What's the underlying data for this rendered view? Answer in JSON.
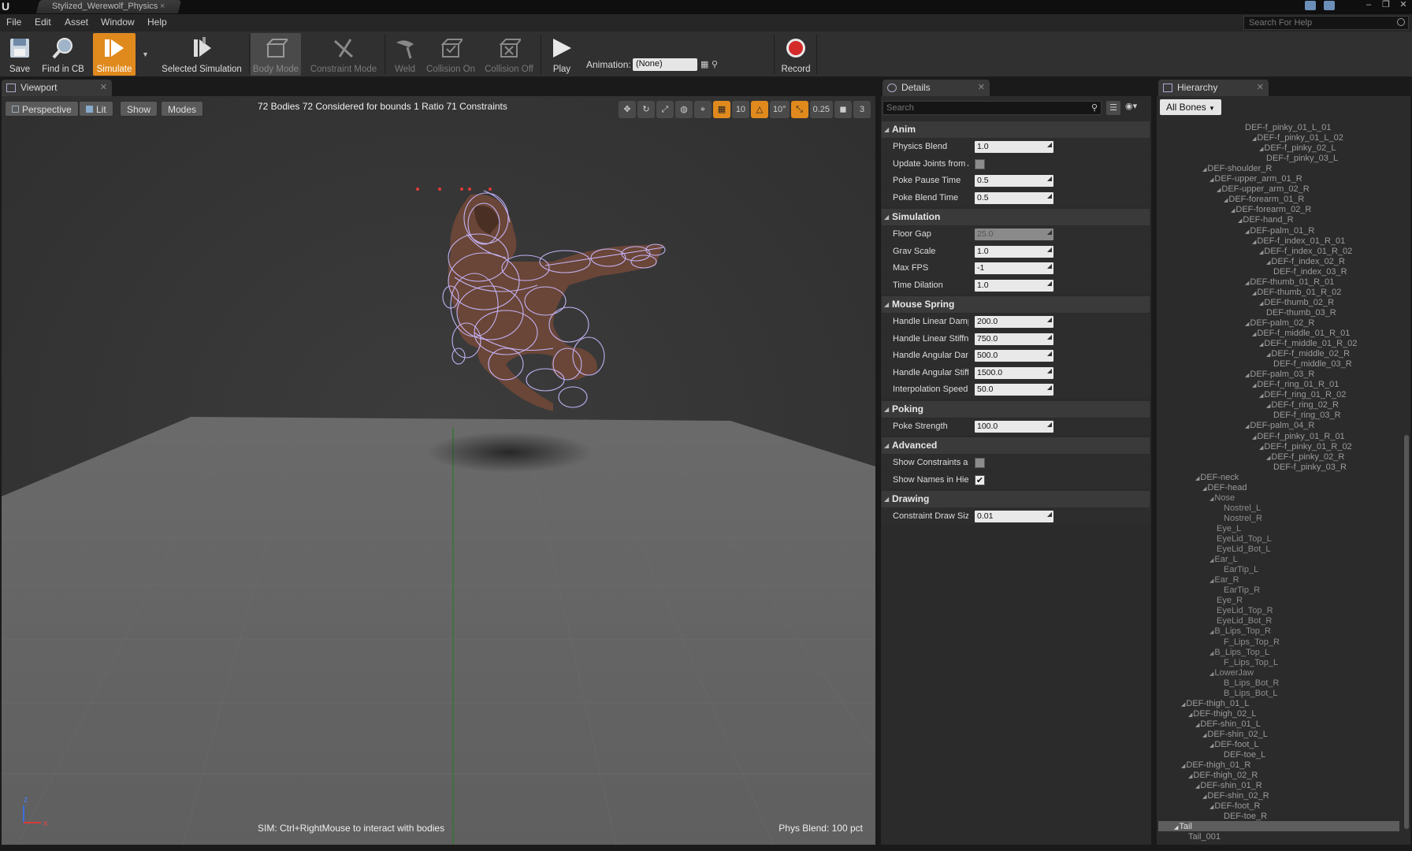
{
  "title_bar": {
    "logo": "U",
    "document_tab": "Stylized_Werewolf_Physics",
    "close": "×"
  },
  "menu": {
    "items": [
      "File",
      "Edit",
      "Asset",
      "Window",
      "Help"
    ],
    "help_search_placeholder": "Search For Help"
  },
  "toolbar": {
    "save": "Save",
    "find_in_cb": "Find in CB",
    "simulate": "Simulate",
    "selected_simulation": "Selected Simulation",
    "body_mode": "Body Mode",
    "constraint_mode": "Constraint Mode",
    "weld": "Weld",
    "collision_on": "Collision On",
    "collision_off": "Collision Off",
    "play": "Play",
    "animation_label": "Animation:",
    "animation_value": "(None)",
    "record": "Record"
  },
  "viewport": {
    "tab_label": "Viewport",
    "perspective": "Perspective",
    "lit": "Lit",
    "show": "Show",
    "modes": "Modes",
    "stats": "72 Bodies  72 Considered for bounds  1 Ratio  71 Constraints",
    "grid_snap": "10",
    "rot_snap": "10°",
    "scale_snap": "0.25",
    "cam_speed": "3",
    "hint": "SIM: Ctrl+RightMouse to interact with bodies",
    "phys_blend": "Phys Blend: 100 pct",
    "axis_x": "x",
    "axis_z": "z"
  },
  "details": {
    "tab_label": "Details",
    "search_placeholder": "Search",
    "categories": [
      {
        "name": "Anim",
        "props": [
          {
            "label": "Physics Blend",
            "value": "1.0"
          },
          {
            "label": "Update Joints from Animation",
            "checkbox": false
          },
          {
            "label": "Poke Pause Time",
            "value": "0.5"
          },
          {
            "label": "Poke Blend Time",
            "value": "0.5"
          }
        ]
      },
      {
        "name": "Simulation",
        "props": [
          {
            "label": "Floor Gap",
            "value": "25.0",
            "disabled": true
          },
          {
            "label": "Grav Scale",
            "value": "1.0"
          },
          {
            "label": "Max FPS",
            "value": "-1"
          },
          {
            "label": "Time Dilation",
            "value": "1.0"
          }
        ]
      },
      {
        "name": "Mouse Spring",
        "props": [
          {
            "label": "Handle Linear Damping",
            "value": "200.0"
          },
          {
            "label": "Handle Linear Stiffness",
            "value": "750.0"
          },
          {
            "label": "Handle Angular Damping",
            "value": "500.0"
          },
          {
            "label": "Handle Angular Stiffness",
            "value": "1500.0"
          },
          {
            "label": "Interpolation Speed",
            "value": "50.0"
          }
        ]
      },
      {
        "name": "Poking",
        "props": [
          {
            "label": "Poke Strength",
            "value": "100.0"
          }
        ]
      },
      {
        "name": "Advanced",
        "props": [
          {
            "label": "Show Constraints as Points",
            "checkbox": false
          },
          {
            "label": "Show Names in Hierarchy",
            "checkbox": true
          }
        ]
      },
      {
        "name": "Drawing",
        "props": [
          {
            "label": "Constraint Draw Size",
            "value": "0.01"
          }
        ]
      }
    ]
  },
  "hierarchy": {
    "tab_label": "Hierarchy",
    "filter": "All Bones",
    "nodes": [
      {
        "label": "DEF-f_pinky_01_L_01",
        "indent": 10,
        "arrow": false,
        "bone": true
      },
      {
        "label": "DEF-f_pinky_01_L_02",
        "indent": 11,
        "arrow": true,
        "bone": true
      },
      {
        "label": "DEF-f_pinky_02_L",
        "indent": 12,
        "arrow": true,
        "bone": true
      },
      {
        "label": "DEF-f_pinky_03_L",
        "indent": 13,
        "arrow": false,
        "bone": true
      },
      {
        "label": "DEF-shoulder_R",
        "indent": 4,
        "arrow": true,
        "bone": true
      },
      {
        "label": "DEF-upper_arm_01_R",
        "indent": 5,
        "arrow": true,
        "bone": true
      },
      {
        "label": "DEF-upper_arm_02_R",
        "indent": 6,
        "arrow": true,
        "bone": true
      },
      {
        "label": "DEF-forearm_01_R",
        "indent": 7,
        "arrow": true,
        "bone": true
      },
      {
        "label": "DEF-forearm_02_R",
        "indent": 8,
        "arrow": true,
        "bone": true
      },
      {
        "label": "DEF-hand_R",
        "indent": 9,
        "arrow": true,
        "bone": true
      },
      {
        "label": "DEF-palm_01_R",
        "indent": 10,
        "arrow": true,
        "bone": true
      },
      {
        "label": "DEF-f_index_01_R_01",
        "indent": 11,
        "arrow": true,
        "bone": true
      },
      {
        "label": "DEF-f_index_01_R_02",
        "indent": 12,
        "arrow": true,
        "bone": true
      },
      {
        "label": "DEF-f_index_02_R",
        "indent": 13,
        "arrow": true,
        "bone": true
      },
      {
        "label": "DEF-f_index_03_R",
        "indent": 14,
        "arrow": false,
        "bone": true
      },
      {
        "label": "DEF-thumb_01_R_01",
        "indent": 10,
        "arrow": true,
        "bone": true
      },
      {
        "label": "DEF-thumb_01_R_02",
        "indent": 11,
        "arrow": true,
        "bone": true
      },
      {
        "label": "DEF-thumb_02_R",
        "indent": 12,
        "arrow": true,
        "bone": true
      },
      {
        "label": "DEF-thumb_03_R",
        "indent": 13,
        "arrow": false,
        "bone": true
      },
      {
        "label": "DEF-palm_02_R",
        "indent": 10,
        "arrow": true,
        "bone": true
      },
      {
        "label": "DEF-f_middle_01_R_01",
        "indent": 11,
        "arrow": true,
        "bone": true
      },
      {
        "label": "DEF-f_middle_01_R_02",
        "indent": 12,
        "arrow": true,
        "bone": true
      },
      {
        "label": "DEF-f_middle_02_R",
        "indent": 13,
        "arrow": true,
        "bone": true
      },
      {
        "label": "DEF-f_middle_03_R",
        "indent": 14,
        "arrow": false,
        "bone": true
      },
      {
        "label": "DEF-palm_03_R",
        "indent": 10,
        "arrow": true,
        "bone": true
      },
      {
        "label": "DEF-f_ring_01_R_01",
        "indent": 11,
        "arrow": true,
        "bone": true
      },
      {
        "label": "DEF-f_ring_01_R_02",
        "indent": 12,
        "arrow": true,
        "bone": true
      },
      {
        "label": "DEF-f_ring_02_R",
        "indent": 13,
        "arrow": true,
        "bone": true
      },
      {
        "label": "DEF-f_ring_03_R",
        "indent": 14,
        "arrow": false,
        "bone": true
      },
      {
        "label": "DEF-palm_04_R",
        "indent": 10,
        "arrow": true,
        "bone": true
      },
      {
        "label": "DEF-f_pinky_01_R_01",
        "indent": 11,
        "arrow": true,
        "bone": true
      },
      {
        "label": "DEF-f_pinky_01_R_02",
        "indent": 12,
        "arrow": true,
        "bone": true
      },
      {
        "label": "DEF-f_pinky_02_R",
        "indent": 13,
        "arrow": true,
        "bone": true
      },
      {
        "label": "DEF-f_pinky_03_R",
        "indent": 14,
        "arrow": false,
        "bone": true
      },
      {
        "label": "DEF-neck",
        "indent": 3,
        "arrow": true,
        "bone": true
      },
      {
        "label": "DEF-head",
        "indent": 4,
        "arrow": true,
        "bone": true
      },
      {
        "label": "Nose",
        "indent": 5,
        "arrow": true,
        "bone": false
      },
      {
        "label": "Nostrel_L",
        "indent": 7,
        "arrow": false,
        "bone": false
      },
      {
        "label": "Nostrel_R",
        "indent": 7,
        "arrow": false,
        "bone": false
      },
      {
        "label": "Eye_L",
        "indent": 6,
        "arrow": false,
        "bone": false
      },
      {
        "label": "EyeLid_Top_L",
        "indent": 6,
        "arrow": false,
        "bone": false
      },
      {
        "label": "EyeLid_Bot_L",
        "indent": 6,
        "arrow": false,
        "bone": false
      },
      {
        "label": "Ear_L",
        "indent": 5,
        "arrow": true,
        "bone": false
      },
      {
        "label": "EarTip_L",
        "indent": 7,
        "arrow": false,
        "bone": false
      },
      {
        "label": "Ear_R",
        "indent": 5,
        "arrow": true,
        "bone": false
      },
      {
        "label": "EarTip_R",
        "indent": 7,
        "arrow": false,
        "bone": false
      },
      {
        "label": "Eye_R",
        "indent": 6,
        "arrow": false,
        "bone": false
      },
      {
        "label": "EyeLid_Top_R",
        "indent": 6,
        "arrow": false,
        "bone": false
      },
      {
        "label": "EyeLid_Bot_R",
        "indent": 6,
        "arrow": false,
        "bone": false
      },
      {
        "label": "B_Lips_Top_R",
        "indent": 5,
        "arrow": true,
        "bone": false
      },
      {
        "label": "F_Lips_Top_R",
        "indent": 7,
        "arrow": false,
        "bone": false
      },
      {
        "label": "B_Lips_Top_L",
        "indent": 5,
        "arrow": true,
        "bone": false
      },
      {
        "label": "F_Lips_Top_L",
        "indent": 7,
        "arrow": false,
        "bone": false
      },
      {
        "label": "LowerJaw",
        "indent": 5,
        "arrow": true,
        "bone": false
      },
      {
        "label": "B_Lips_Bot_R",
        "indent": 7,
        "arrow": false,
        "bone": false
      },
      {
        "label": "B_Lips_Bot_L",
        "indent": 7,
        "arrow": false,
        "bone": false
      },
      {
        "label": "DEF-thigh_01_L",
        "indent": 1,
        "arrow": true,
        "bone": true
      },
      {
        "label": "DEF-thigh_02_L",
        "indent": 2,
        "arrow": true,
        "bone": true
      },
      {
        "label": "DEF-shin_01_L",
        "indent": 3,
        "arrow": true,
        "bone": true
      },
      {
        "label": "DEF-shin_02_L",
        "indent": 4,
        "arrow": true,
        "bone": true
      },
      {
        "label": "DEF-foot_L",
        "indent": 5,
        "arrow": true,
        "bone": true
      },
      {
        "label": "DEF-toe_L",
        "indent": 7,
        "arrow": false,
        "bone": true
      },
      {
        "label": "DEF-thigh_01_R",
        "indent": 1,
        "arrow": true,
        "bone": true
      },
      {
        "label": "DEF-thigh_02_R",
        "indent": 2,
        "arrow": true,
        "bone": true
      },
      {
        "label": "DEF-shin_01_R",
        "indent": 3,
        "arrow": true,
        "bone": true
      },
      {
        "label": "DEF-shin_02_R",
        "indent": 4,
        "arrow": true,
        "bone": true
      },
      {
        "label": "DEF-foot_R",
        "indent": 5,
        "arrow": true,
        "bone": true
      },
      {
        "label": "DEF-toe_R",
        "indent": 7,
        "arrow": false,
        "bone": true
      },
      {
        "label": "Tail",
        "indent": 0,
        "arrow": true,
        "bone": true,
        "selected": true
      },
      {
        "label": "Tail_001",
        "indent": 2,
        "arrow": false,
        "bone": true
      }
    ]
  },
  "colors": {
    "accent": "#e08a1e",
    "wireframe": "#c9b8ff",
    "record": "#d42a2a"
  }
}
